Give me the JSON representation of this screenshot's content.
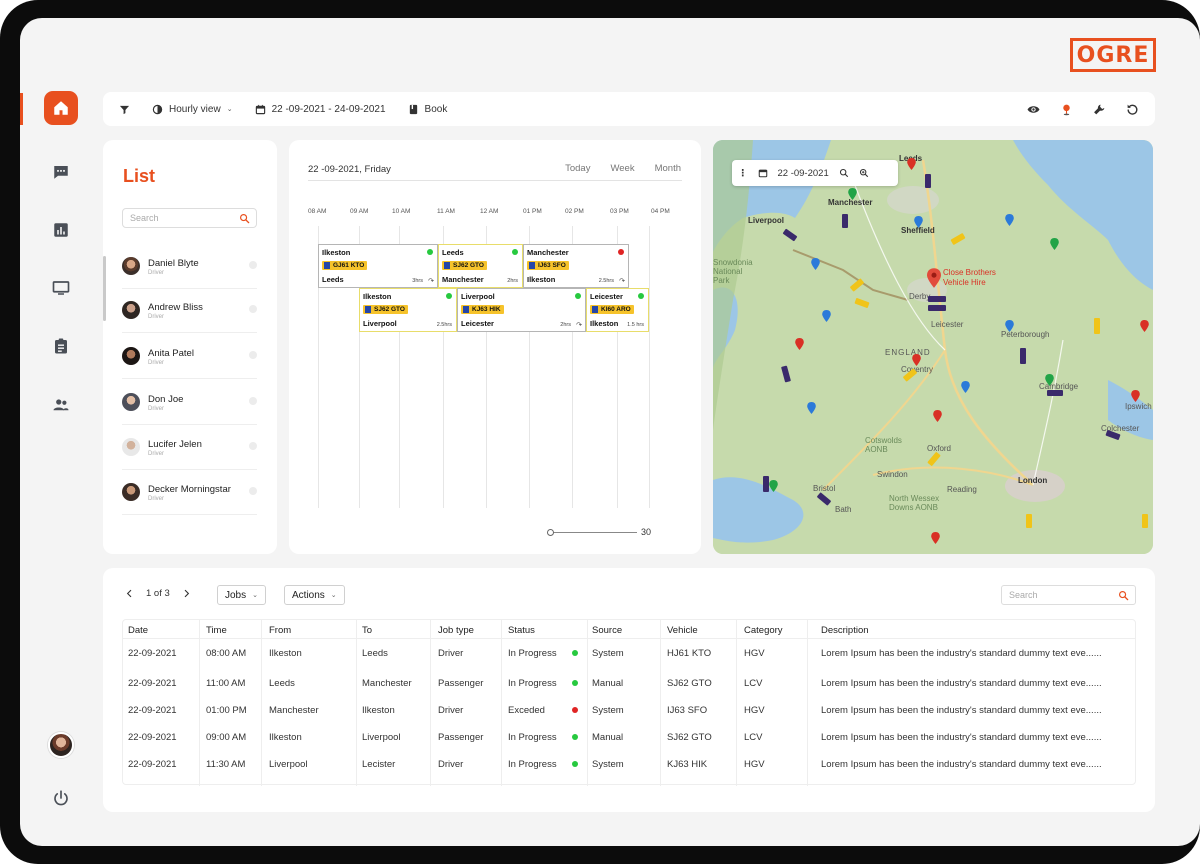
{
  "brand": {
    "logo": "OGRE",
    "accent_color": "#e8501f"
  },
  "sidebar": {
    "items": [
      {
        "name": "home",
        "icon": "home-icon",
        "active": true
      },
      {
        "name": "messages",
        "icon": "chat-icon",
        "active": false
      },
      {
        "name": "reports",
        "icon": "bar-chart-icon",
        "active": false
      },
      {
        "name": "monitor",
        "icon": "monitor-icon",
        "active": false
      },
      {
        "name": "tasks",
        "icon": "clipboard-icon",
        "active": false
      },
      {
        "name": "users",
        "icon": "users-icon",
        "active": false
      }
    ],
    "avatar": "user-avatar",
    "power": "power-icon"
  },
  "toolbar": {
    "view": "Hourly view",
    "date_range": "22 -09-2021 - 24-09-2021",
    "book": "Book",
    "right_icons": [
      "eye-icon",
      "pin-icon",
      "wrench-icon",
      "refresh-icon"
    ]
  },
  "list": {
    "title": "List",
    "search_placeholder": "Search",
    "drivers": [
      {
        "name": "Daniel Blyte",
        "role": "Driver"
      },
      {
        "name": "Andrew Bliss",
        "role": "Driver"
      },
      {
        "name": "Anita Patel",
        "role": "Driver"
      },
      {
        "name": "Don Joe",
        "role": "Driver"
      },
      {
        "name": "Lucifer Jelen",
        "role": "Driver"
      },
      {
        "name": "Decker Morningstar",
        "role": "Driver"
      }
    ]
  },
  "schedule": {
    "date": "22 -09-2021, Friday",
    "tabs": [
      "Today",
      "Week",
      "Month"
    ],
    "hours": [
      "08 AM",
      "09 AM",
      "10 AM",
      "11 AM",
      "12 AM",
      "01 PM",
      "02 PM",
      "03 PM",
      "04 PM"
    ],
    "jobs": [
      {
        "from": "Ilkeston",
        "plate": "GJ61 KTO",
        "to": "Leeds",
        "duration": "3hrs",
        "status_color": "#27c93f"
      },
      {
        "from": "Leeds",
        "plate": "SJ62 GTO",
        "to": "Manchester",
        "duration": "2hrs",
        "status_color": "#27c93f"
      },
      {
        "from": "Manchester",
        "plate": "IJ63 SFO",
        "to": "Ilkeston",
        "duration": "2.5hrs",
        "status_color": "#e02424"
      },
      {
        "from": "Ilkeston",
        "plate": "SJ62 GTO",
        "to": "Liverpool",
        "duration": "2.5hrs",
        "status_color": "#27c93f"
      },
      {
        "from": "Liverpool",
        "plate": "KJ63 HIK",
        "to": "Leicester",
        "duration": "2hrs",
        "status_color": "#27c93f"
      },
      {
        "from": "Leicester",
        "plate": "KI60 ARO",
        "to": "Ilkeston",
        "duration": "1.5 hrs",
        "status_color": "#27c93f"
      }
    ],
    "slider_value": "30"
  },
  "map": {
    "date": "22 -09-2021",
    "places": [
      "Leeds",
      "Manchester",
      "Liverpool",
      "Sheffield",
      "Derby",
      "Leicester",
      "Peterborough",
      "ENGLAND",
      "Coventry",
      "Cambridge",
      "Ipswich",
      "Colchester",
      "Oxford",
      "Swindon",
      "Bristol",
      "Bath",
      "Reading",
      "London",
      "Cotswolds AONB",
      "North Wessex Downs AONB",
      "Snowdonia National Park"
    ],
    "highlight": "Close Brothers Vehicle Hire"
  },
  "jobs_table": {
    "page": "1 of 3",
    "jobs_dropdown": "Jobs",
    "actions_dropdown": "Actions",
    "search_placeholder": "Search",
    "columns": [
      "Date",
      "Time",
      "From",
      "To",
      "Job type",
      "Status",
      "Source",
      "Vehicle",
      "Category",
      "Description"
    ],
    "rows": [
      {
        "date": "22-09-2021",
        "time": "08:00 AM",
        "from": "Ilkeston",
        "to": "Leeds",
        "job_type": "Driver",
        "status": "In Progress",
        "status_color": "#27c93f",
        "source": "System",
        "vehicle": "HJ61 KTO",
        "category": "HGV",
        "description": "Lorem Ipsum has been the industry's standard dummy text eve......"
      },
      {
        "date": "22-09-2021",
        "time": "11:00 AM",
        "from": "Leeds",
        "to": "Manchester",
        "job_type": "Passenger",
        "status": "In Progress",
        "status_color": "#27c93f",
        "source": "Manual",
        "vehicle": "SJ62 GTO",
        "category": "LCV",
        "description": "Lorem Ipsum has been the industry's standard dummy text eve......"
      },
      {
        "date": "22-09-2021",
        "time": "01:00 PM",
        "from": "Manchester",
        "to": "Ilkeston",
        "job_type": "Driver",
        "status": "Exceded",
        "status_color": "#e02424",
        "source": "System",
        "vehicle": "IJ63 SFO",
        "category": "HGV",
        "description": "Lorem Ipsum has been the industry's standard dummy text eve......"
      },
      {
        "date": "22-09-2021",
        "time": "09:00 AM",
        "from": "Ilkeston",
        "to": "Liverpool",
        "job_type": "Passenger",
        "status": "In Progress",
        "status_color": "#27c93f",
        "source": "Manual",
        "vehicle": "SJ62 GTO",
        "category": "LCV",
        "description": "Lorem Ipsum has been the industry's standard dummy text eve......"
      },
      {
        "date": "22-09-2021",
        "time": "11:30 AM",
        "from": "Liverpool",
        "to": "Lecister",
        "job_type": "Driver",
        "status": "In Progress",
        "status_color": "#27c93f",
        "source": "System",
        "vehicle": "KJ63 HIK",
        "category": "HGV",
        "description": "Lorem Ipsum has been the industry's standard dummy text eve......"
      }
    ]
  }
}
